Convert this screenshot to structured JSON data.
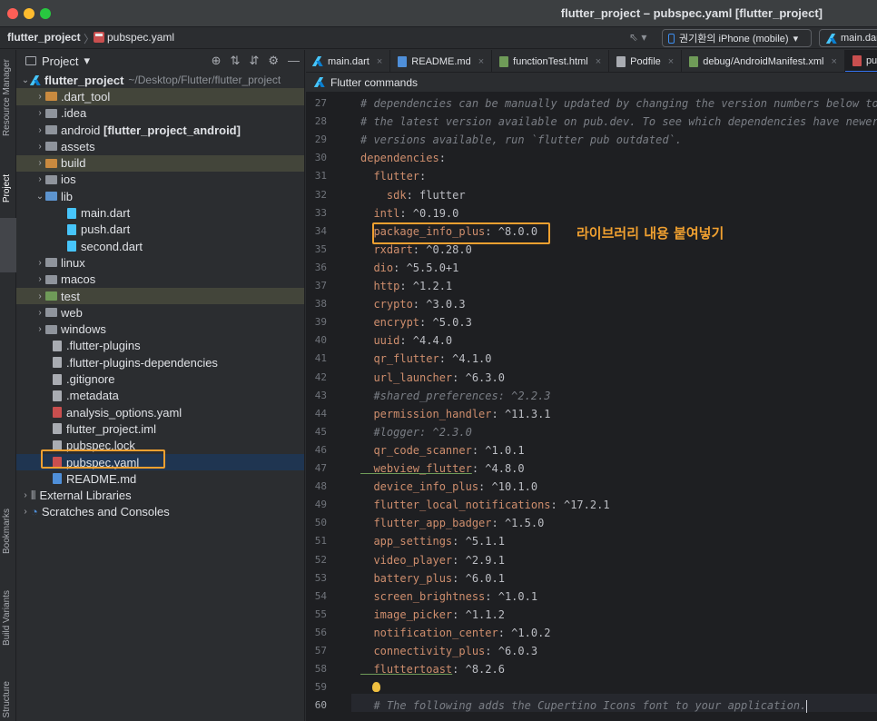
{
  "window": {
    "title": "flutter_project – pubspec.yaml [flutter_project]"
  },
  "navbar": {
    "project": "flutter_project",
    "separator": "〉",
    "file": "pubspec.yaml",
    "device": "권기환의 iPhone (mobile)",
    "run_config": "main.dart"
  },
  "toolstrip": {
    "resource_manager": "Resource Manager",
    "project": "Project",
    "bookmarks": "Bookmarks",
    "build_variants": "Build Variants",
    "structure": "Structure"
  },
  "project_panel": {
    "title": "Project",
    "root_name": "flutter_project",
    "root_path": "~/Desktop/Flutter/flutter_project",
    "items": [
      {
        "label": ".dart_tool",
        "arrow": "›"
      },
      {
        "label": ".idea",
        "arrow": "›"
      },
      {
        "label": "android",
        "suffix": "[flutter_project_android]",
        "arrow": "›"
      },
      {
        "label": "assets",
        "arrow": "›"
      },
      {
        "label": "build",
        "arrow": "›"
      },
      {
        "label": "ios",
        "arrow": "›"
      },
      {
        "label": "lib",
        "arrow": "⌄"
      },
      {
        "label": "main.dart"
      },
      {
        "label": "push.dart"
      },
      {
        "label": "second.dart"
      },
      {
        "label": "linux",
        "arrow": "›"
      },
      {
        "label": "macos",
        "arrow": "›"
      },
      {
        "label": "test",
        "arrow": "›"
      },
      {
        "label": "web",
        "arrow": "›"
      },
      {
        "label": "windows",
        "arrow": "›"
      },
      {
        "label": ".flutter-plugins"
      },
      {
        "label": ".flutter-plugins-dependencies"
      },
      {
        "label": ".gitignore"
      },
      {
        "label": ".metadata"
      },
      {
        "label": "analysis_options.yaml"
      },
      {
        "label": "flutter_project.iml"
      },
      {
        "label": "pubspec.lock"
      },
      {
        "label": "pubspec.yaml"
      },
      {
        "label": "README.md"
      },
      {
        "label": "External Libraries",
        "arrow": "›"
      },
      {
        "label": "Scratches and Consoles",
        "arrow": "›"
      }
    ]
  },
  "tabs": [
    {
      "label": "main.dart"
    },
    {
      "label": "README.md"
    },
    {
      "label": "functionTest.html"
    },
    {
      "label": "Podfile"
    },
    {
      "label": "debug/AndroidManifest.xml"
    },
    {
      "label": "pubspec.yaml"
    }
  ],
  "editor": {
    "command_bar": "Flutter commands",
    "annotation": "라이브러리 내용 붙여넣기",
    "lines": [
      {
        "n": "27",
        "key": "",
        "val": "# dependencies can be manually updated by changing the version numbers below to"
      },
      {
        "n": "28",
        "key": "",
        "val": "# the latest version available on pub.dev. To see which dependencies have newer"
      },
      {
        "n": "29",
        "key": "",
        "val": "# versions available, run `flutter pub outdated`."
      },
      {
        "n": "30",
        "key": "dependencies",
        "val": ":"
      },
      {
        "n": "31",
        "key": "  flutter",
        "val": ":"
      },
      {
        "n": "32",
        "key": "    sdk",
        "val": ": flutter"
      },
      {
        "n": "33",
        "key": "  intl",
        "val": ": ^0.19.0"
      },
      {
        "n": "34",
        "key": "  package_info_plus",
        "val": ": ^8.0.0"
      },
      {
        "n": "35",
        "key": "  rxdart",
        "val": ": ^0.28.0"
      },
      {
        "n": "36",
        "key": "  dio",
        "val": ": ^5.5.0+1"
      },
      {
        "n": "37",
        "key": "  http",
        "val": ": ^1.2.1"
      },
      {
        "n": "38",
        "key": "  crypto",
        "val": ": ^3.0.3"
      },
      {
        "n": "39",
        "key": "  encrypt",
        "val": ": ^5.0.3"
      },
      {
        "n": "40",
        "key": "  uuid",
        "val": ": ^4.4.0"
      },
      {
        "n": "41",
        "key": "  qr_flutter",
        "val": ": ^4.1.0"
      },
      {
        "n": "42",
        "key": "  url_launcher",
        "val": ": ^6.3.0"
      },
      {
        "n": "43",
        "key": "",
        "val": "  #shared_preferences: ^2.2.3"
      },
      {
        "n": "44",
        "key": "  permission_handler",
        "val": ": ^11.3.1"
      },
      {
        "n": "45",
        "key": "",
        "val": "  #logger: ^2.3.0"
      },
      {
        "n": "46",
        "key": "  qr_code_scanner",
        "val": ": ^1.0.1"
      },
      {
        "n": "47",
        "key": "  webview_flutter",
        "val": ": ^4.8.0"
      },
      {
        "n": "48",
        "key": "  device_info_plus",
        "val": ": ^10.1.0"
      },
      {
        "n": "49",
        "key": "  flutter_local_notifications",
        "val": ": ^17.2.1"
      },
      {
        "n": "50",
        "key": "  flutter_app_badger",
        "val": ": ^1.5.0"
      },
      {
        "n": "51",
        "key": "  app_settings",
        "val": ": ^5.1.1"
      },
      {
        "n": "52",
        "key": "  video_player",
        "val": ": ^2.9.1"
      },
      {
        "n": "53",
        "key": "  battery_plus",
        "val": ": ^6.0.1"
      },
      {
        "n": "54",
        "key": "  screen_brightness",
        "val": ": ^1.0.1"
      },
      {
        "n": "55",
        "key": "  image_picker",
        "val": ": ^1.1.2"
      },
      {
        "n": "56",
        "key": "  notification_center",
        "val": ": ^1.0.2"
      },
      {
        "n": "57",
        "key": "  connectivity_plus",
        "val": ": ^6.0.3"
      },
      {
        "n": "58",
        "key": "  fluttertoast",
        "val": ": ^8.2.6"
      },
      {
        "n": "59",
        "key": "",
        "val": ""
      },
      {
        "n": "60",
        "key": "",
        "val": "  # The following adds the Cupertino Icons font to your application."
      }
    ]
  }
}
